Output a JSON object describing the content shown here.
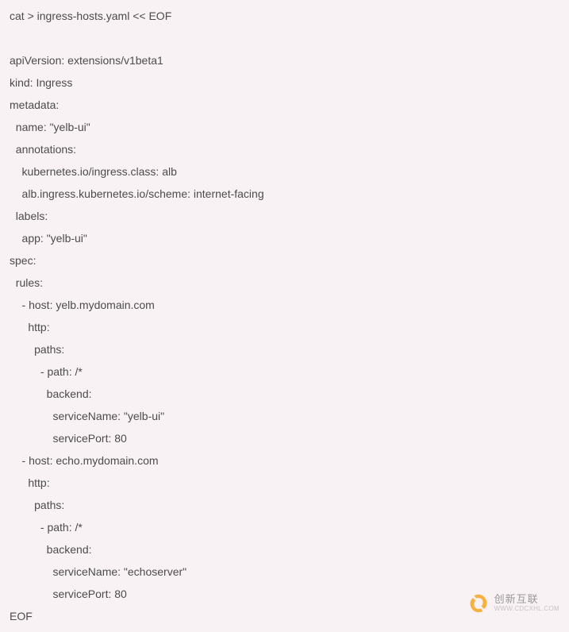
{
  "code": {
    "lines": [
      "cat > ingress-hosts.yaml << EOF",
      "",
      "apiVersion: extensions/v1beta1",
      "kind: Ingress",
      "metadata:",
      "  name: \"yelb-ui\"",
      "  annotations:",
      "    kubernetes.io/ingress.class: alb",
      "    alb.ingress.kubernetes.io/scheme: internet-facing",
      "  labels:",
      "    app: \"yelb-ui\"",
      "spec:",
      "  rules:",
      "    - host: yelb.mydomain.com",
      "      http:",
      "        paths:",
      "          - path: /*",
      "            backend:",
      "              serviceName: \"yelb-ui\"",
      "              servicePort: 80",
      "    - host: echo.mydomain.com",
      "      http:",
      "        paths:",
      "          - path: /*",
      "            backend:",
      "              serviceName: \"echoserver\"",
      "              servicePort: 80",
      "EOF"
    ]
  },
  "watermark": {
    "main": "创新互联",
    "sub": "WWW.CDCXHL.COM"
  }
}
